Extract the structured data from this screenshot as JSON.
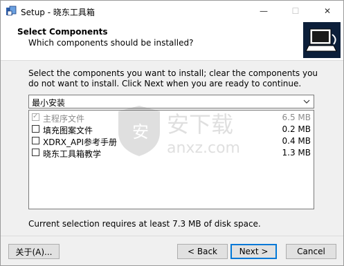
{
  "window": {
    "title": "Setup - 晓东工具箱",
    "min_glyph": "—",
    "max_glyph": "☐",
    "close_glyph": "✕"
  },
  "header": {
    "title": "Select Components",
    "subtitle": "Which components should be installed?"
  },
  "main": {
    "description": "Select the components you want to install; clear the components you do not want to install. Click Next when you are ready to continue.",
    "install_type": "最小安装",
    "components": [
      {
        "label": "主程序文件",
        "size": "6.5 MB",
        "checked": true,
        "disabled": true
      },
      {
        "label": "填充图案文件",
        "size": "0.2 MB",
        "checked": false,
        "disabled": false
      },
      {
        "label": "XDRX_API参考手册",
        "size": "0.4 MB",
        "checked": false,
        "disabled": false
      },
      {
        "label": "晓东工具箱教学",
        "size": "1.3 MB",
        "checked": false,
        "disabled": false
      }
    ],
    "disk_space": "Current selection requires at least 7.3 MB of disk space."
  },
  "buttons": {
    "about": "关于(A)...",
    "back": "< Back",
    "next": "Next >",
    "cancel": "Cancel"
  },
  "watermark": {
    "text_cn": "安下载",
    "text_en": "anxz.com"
  }
}
